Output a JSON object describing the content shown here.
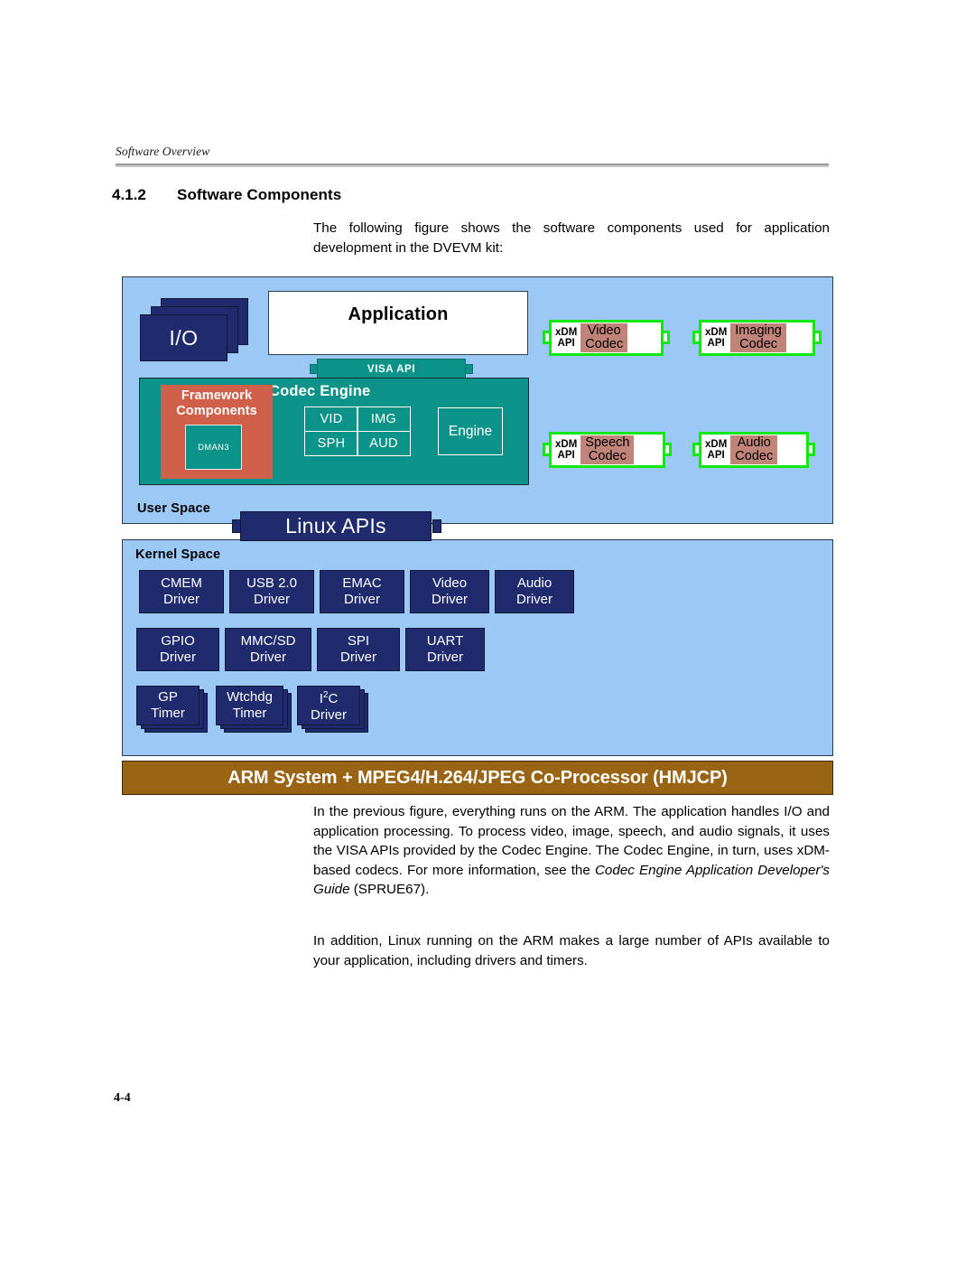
{
  "header": {
    "running_head": "Software Overview"
  },
  "section": {
    "number": "4.1.2",
    "title": "Software Components"
  },
  "body": {
    "intro": "The following figure shows the software components used for application development in the DVEVM kit:",
    "after_figure_part1": "In the previous figure, everything runs on the ARM. The application handles I/O and application processing. To process video, image, speech, and audio signals, it uses the VISA APIs provided by the Codec Engine. The Codec Engine, in turn, uses xDM-based codecs. For more information, see the ",
    "after_figure_italic": "Codec Engine Application Developer's Guide",
    "after_figure_part2": " (SPRUE67).",
    "last_para": "In addition, Linux running on the ARM makes a large number of APIs available to your application, including drivers and timers."
  },
  "footer": {
    "page_number": "4-4"
  },
  "figure": {
    "user_space_label": "User Space",
    "kernel_space_label": "Kernel Space",
    "io_label": "I/O",
    "application_label": "Application",
    "visa_api_label": "VISA API",
    "codec_engine_title": "Codec Engine",
    "framework_title": "Framework\nComponents",
    "dman3_label": "DMAN3",
    "visa_cells": [
      "VID",
      "IMG",
      "SPH",
      "AUD"
    ],
    "engine_label": "Engine",
    "codecs": [
      {
        "api": "xDM\nAPI",
        "name": "Video\nCodec"
      },
      {
        "api": "xDM\nAPI",
        "name": "Imaging\nCodec"
      },
      {
        "api": "xDM\nAPI",
        "name": "Speech\nCodec"
      },
      {
        "api": "xDM\nAPI",
        "name": "Audio\nCodec"
      }
    ],
    "linux_apis_label": "Linux APIs",
    "drivers_row1": [
      {
        "line1": "CMEM",
        "line2": "Driver"
      },
      {
        "line1": "USB 2.0",
        "line2": "Driver"
      },
      {
        "line1": "EMAC",
        "line2": "Driver"
      },
      {
        "line1": "Video",
        "line2": "Driver"
      },
      {
        "line1": "Audio",
        "line2": "Driver"
      }
    ],
    "drivers_row2": [
      {
        "line1": "GPIO",
        "line2": "Driver"
      },
      {
        "line1": "MMC/SD",
        "line2": "Driver"
      },
      {
        "line1": "SPI",
        "line2": "Driver"
      },
      {
        "line1": "UART",
        "line2": "Driver"
      }
    ],
    "drivers_row3": [
      {
        "line1": "GP",
        "line2": "Timer"
      },
      {
        "line1": "Wtchdg",
        "line2": "Timer"
      },
      {
        "line1": "I2C",
        "line2": "Driver"
      }
    ],
    "arm_bar_label": "ARM System + MPEG4/H.264/JPEG Co-Processor (HMJCP)",
    "colors": {
      "panel_blue": "#9CC8F5",
      "navy": "#1F2B6C",
      "teal": "#0C9389",
      "terracotta": "#D1604A",
      "codec_green_border": "#10E810",
      "codec_rose": "#C08478",
      "arm_gold": "#996515"
    }
  }
}
